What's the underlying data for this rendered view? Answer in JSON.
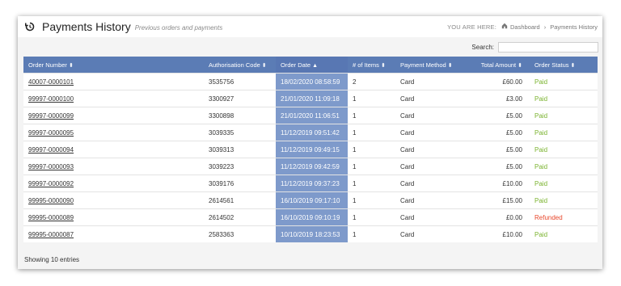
{
  "header": {
    "title": "Payments History",
    "subtitle": "Previous orders and payments",
    "breadcrumb": {
      "label": "YOU ARE HERE:",
      "items": [
        "Dashboard",
        "Payments History"
      ]
    }
  },
  "search": {
    "label": "Search:",
    "value": ""
  },
  "table": {
    "columns": [
      "Order Number",
      "Authorisation Code",
      "Order Date",
      "# of Items",
      "Payment Method",
      "Total Amount",
      "Order Status"
    ],
    "rows": [
      {
        "order": "40007-0000101",
        "auth": "3535756",
        "date": "18/02/2020 08:58:59",
        "items": "2",
        "method": "Card",
        "total": "£60.00",
        "status": "Paid"
      },
      {
        "order": "99997-0000100",
        "auth": "3300927",
        "date": "21/01/2020 11:09:18",
        "items": "1",
        "method": "Card",
        "total": "£3.00",
        "status": "Paid"
      },
      {
        "order": "99997-0000099",
        "auth": "3300898",
        "date": "21/01/2020 11:06:51",
        "items": "1",
        "method": "Card",
        "total": "£5.00",
        "status": "Paid"
      },
      {
        "order": "99997-0000095",
        "auth": "3039335",
        "date": "11/12/2019 09:51:42",
        "items": "1",
        "method": "Card",
        "total": "£5.00",
        "status": "Paid"
      },
      {
        "order": "99997-0000094",
        "auth": "3039313",
        "date": "11/12/2019 09:49:15",
        "items": "1",
        "method": "Card",
        "total": "£5.00",
        "status": "Paid"
      },
      {
        "order": "99997-0000093",
        "auth": "3039223",
        "date": "11/12/2019 09:42:59",
        "items": "1",
        "method": "Card",
        "total": "£5.00",
        "status": "Paid"
      },
      {
        "order": "99997-0000092",
        "auth": "3039176",
        "date": "11/12/2019 09:37:23",
        "items": "1",
        "method": "Card",
        "total": "£10.00",
        "status": "Paid"
      },
      {
        "order": "99995-0000090",
        "auth": "2614561",
        "date": "16/10/2019 09:17:10",
        "items": "1",
        "method": "Card",
        "total": "£15.00",
        "status": "Paid"
      },
      {
        "order": "99995-0000089",
        "auth": "2614502",
        "date": "16/10/2019 09:10:19",
        "items": "1",
        "method": "Card",
        "total": "£0.00",
        "status": "Refunded"
      },
      {
        "order": "99995-0000087",
        "auth": "2583363",
        "date": "10/10/2019 18:23:53",
        "items": "1",
        "method": "Card",
        "total": "£10.00",
        "status": "Paid"
      }
    ]
  },
  "footer": {
    "entries_text": "Showing 10 entries"
  },
  "colors": {
    "header_bg": "#5b7cb5",
    "sorted_col_bg": "#7e9acb",
    "paid": "#7ab32e",
    "refunded": "#e8472b"
  },
  "icons": {
    "title": "history-icon",
    "breadcrumb_home": "home-icon",
    "sort": "sort-icon",
    "sort_active": "sort-asc-icon"
  }
}
